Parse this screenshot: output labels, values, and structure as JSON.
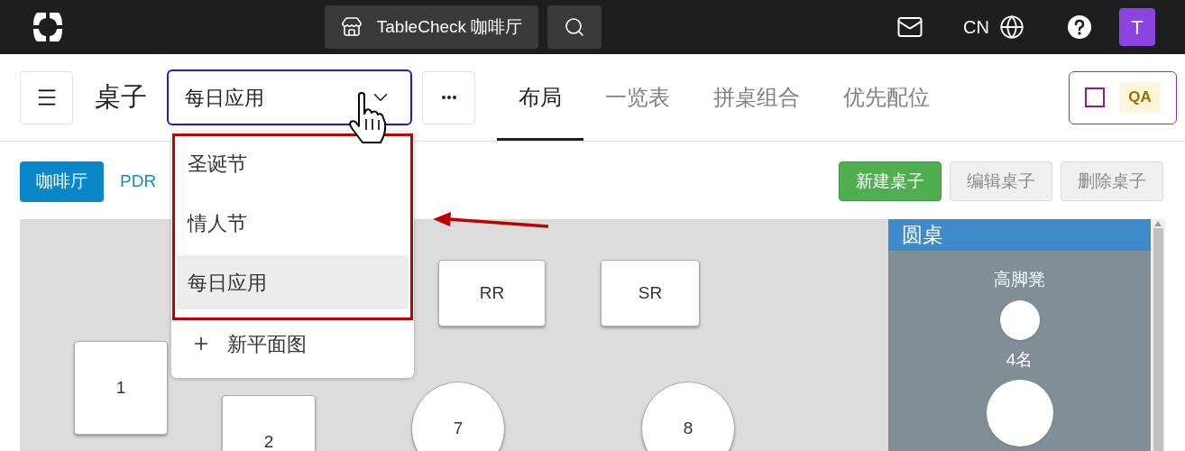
{
  "top_bar": {
    "store": "TableCheck 咖啡厅",
    "language": "CN",
    "avatar": "T"
  },
  "header": {
    "title": "桌子",
    "layout_select": {
      "value": "每日应用",
      "expanded": true
    },
    "tabs": [
      {
        "label": "布局",
        "selected": true
      },
      {
        "label": "一览表",
        "selected": false
      },
      {
        "label": "拼桌组合",
        "selected": false
      },
      {
        "label": "优先配位",
        "selected": false
      }
    ],
    "qa": {
      "checked": false,
      "badge": "QA"
    }
  },
  "dropdown": {
    "items": [
      {
        "label": "圣诞节",
        "selected": false
      },
      {
        "label": "情人节",
        "selected": false
      },
      {
        "label": "每日应用",
        "selected": true
      }
    ],
    "add": "新平面图"
  },
  "areas": [
    {
      "label": "咖啡厅",
      "selected": true
    },
    {
      "label": "PDR",
      "selected": false
    }
  ],
  "actions": [
    {
      "label": "新建桌子",
      "disabled": false
    },
    {
      "label": "编辑桌子",
      "disabled": true
    },
    {
      "label": "删除桌子",
      "disabled": true
    }
  ],
  "tables": [
    {
      "label": "1",
      "kind": "square"
    },
    {
      "label": "2",
      "kind": "square"
    },
    {
      "label": "RR",
      "kind": "rect"
    },
    {
      "label": "SR",
      "kind": "rect"
    },
    {
      "label": "7",
      "kind": "round"
    },
    {
      "label": "8",
      "kind": "round"
    }
  ],
  "side_panel": {
    "title": "圆桌",
    "items": [
      {
        "label": "高脚凳",
        "kind": "stool"
      },
      {
        "label": "4名",
        "kind": "round"
      }
    ]
  }
}
